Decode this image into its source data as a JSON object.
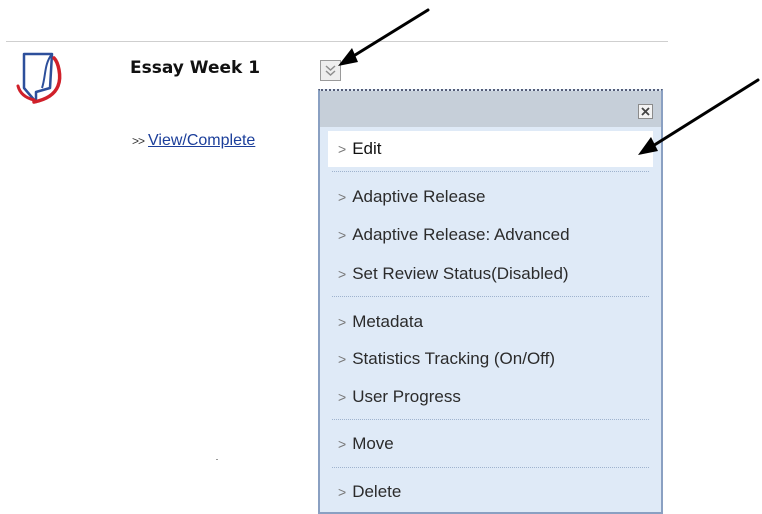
{
  "item": {
    "title": "Essay Week 1",
    "link_prefix": ">>",
    "link_label": "View/Complete"
  },
  "icons": {
    "assignment": "assignment-icon",
    "toggle": "chevron-down-icon",
    "close": "close-icon",
    "item_chevron": "chevron-right-icon",
    "annotation": "arrow-icon"
  },
  "menu": {
    "close_label": "✕",
    "items": [
      {
        "label": "Edit"
      },
      {
        "label": "Adaptive Release"
      },
      {
        "label": "Adaptive Release: Advanced"
      },
      {
        "label": "Set Review Status(Disabled)"
      },
      {
        "label": "Metadata"
      },
      {
        "label": "Statistics Tracking (On/Off)"
      },
      {
        "label": "User Progress"
      },
      {
        "label": "Move"
      },
      {
        "label": "Delete"
      }
    ]
  },
  "colors": {
    "link": "#1b3e9a",
    "menu_bg": "#dfeaf7",
    "menu_header": "#c6cfd9",
    "icon_red": "#d0202a",
    "icon_blue": "#2d4f9b"
  }
}
